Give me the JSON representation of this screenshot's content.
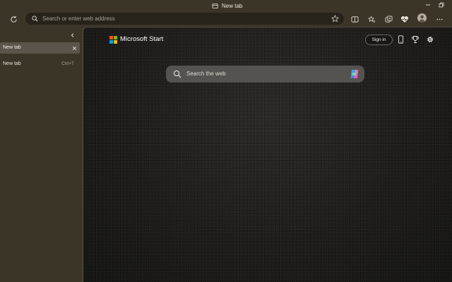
{
  "window": {
    "title": "New tab"
  },
  "toolbar": {
    "address_placeholder": "Search or enter web address"
  },
  "sidebar": {
    "active_tab": {
      "label": "New tab"
    },
    "new_tab": {
      "label": "New tab",
      "shortcut": "Ctrl+T"
    }
  },
  "newtab_page": {
    "brand": "Microsoft Start",
    "signin_label": "Sign in",
    "search_placeholder": "Search the web"
  },
  "colors": {
    "chrome_background": "#3b3528",
    "address_bar": "#27231a",
    "active_tab": "#5a544a",
    "search_box": "#55534f",
    "ms_red": "#f25022",
    "ms_green": "#7fba00",
    "ms_blue": "#00a4ef",
    "ms_yellow": "#ffb900"
  }
}
